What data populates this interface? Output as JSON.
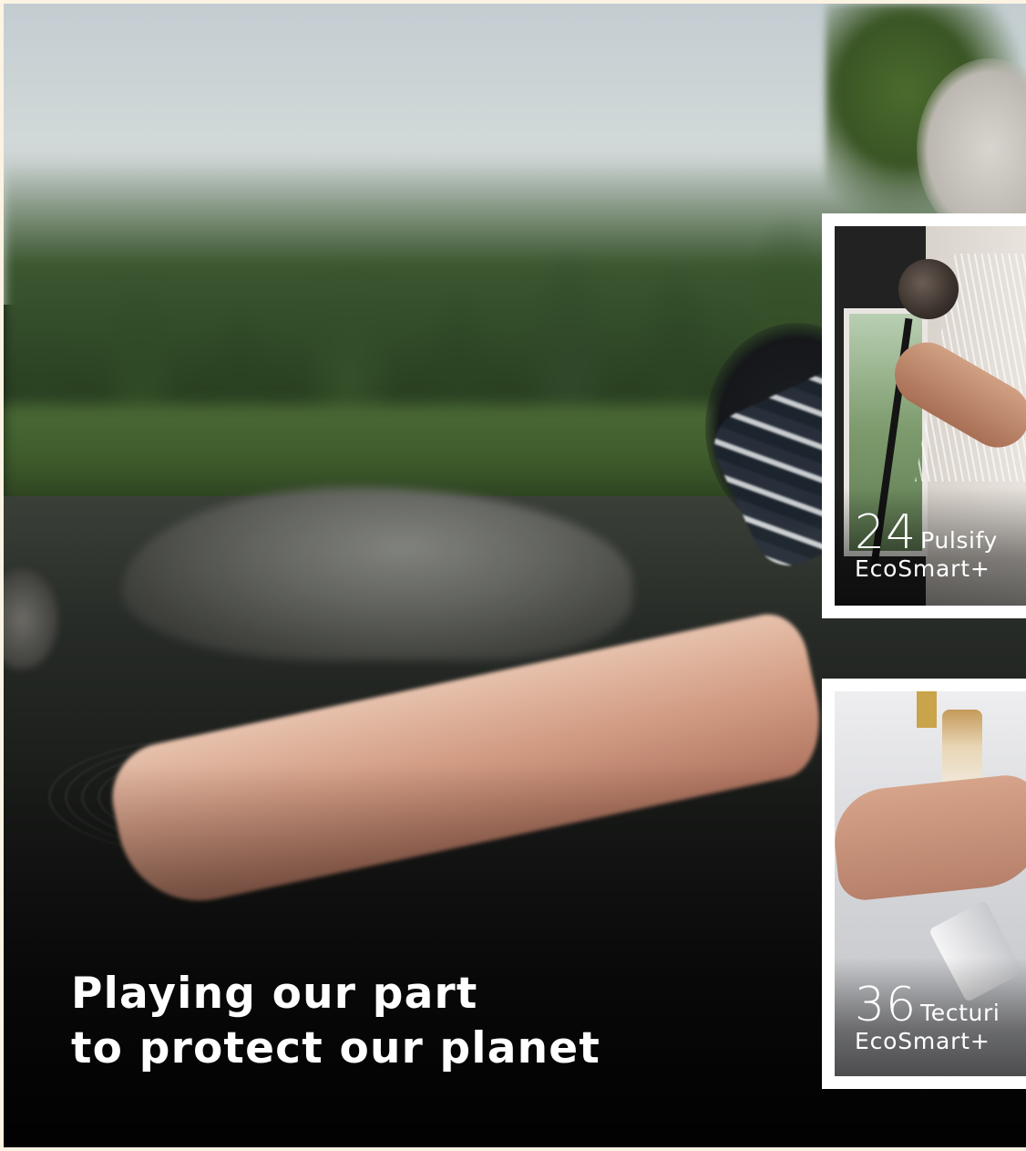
{
  "headline": {
    "line1": "Playing our part",
    "line2": "to protect our planet"
  },
  "cards": [
    {
      "number": "24",
      "name": "Pulsify",
      "subtitle": "EcoSmart+"
    },
    {
      "number": "36",
      "name": "Tecturi",
      "subtitle": "EcoSmart+"
    }
  ],
  "colors": {
    "frame_background": "#fdf3e3",
    "headline_text": "#ffffff",
    "card_border": "#ffffff"
  }
}
